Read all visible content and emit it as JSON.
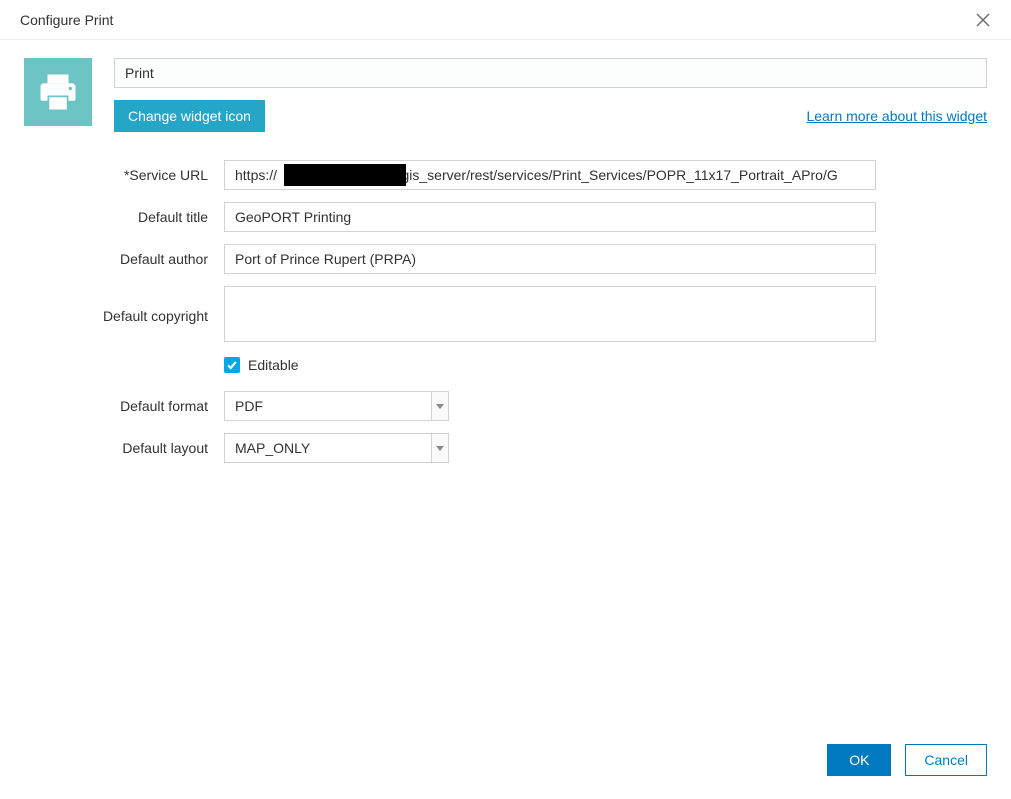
{
  "dialog": {
    "title": "Configure Print"
  },
  "header": {
    "widget_name_value": "Print",
    "change_icon_label": "Change widget icon",
    "learn_more_label": "Learn more about this widget"
  },
  "form": {
    "service_url": {
      "label": "*Service URL",
      "value": "https://                          /arcgis_server/rest/services/Print_Services/POPR_11x17_Portrait_APro/G"
    },
    "default_title": {
      "label": "Default title",
      "value": "GeoPORT Printing"
    },
    "default_author": {
      "label": "Default author",
      "value": "Port of Prince Rupert (PRPA)"
    },
    "default_copyright": {
      "label": "Default copyright",
      "value": ""
    },
    "editable": {
      "label": "Editable",
      "checked": true
    },
    "default_format": {
      "label": "Default format",
      "value": "PDF"
    },
    "default_layout": {
      "label": "Default layout",
      "value": "MAP_ONLY"
    }
  },
  "footer": {
    "ok_label": "OK",
    "cancel_label": "Cancel"
  }
}
